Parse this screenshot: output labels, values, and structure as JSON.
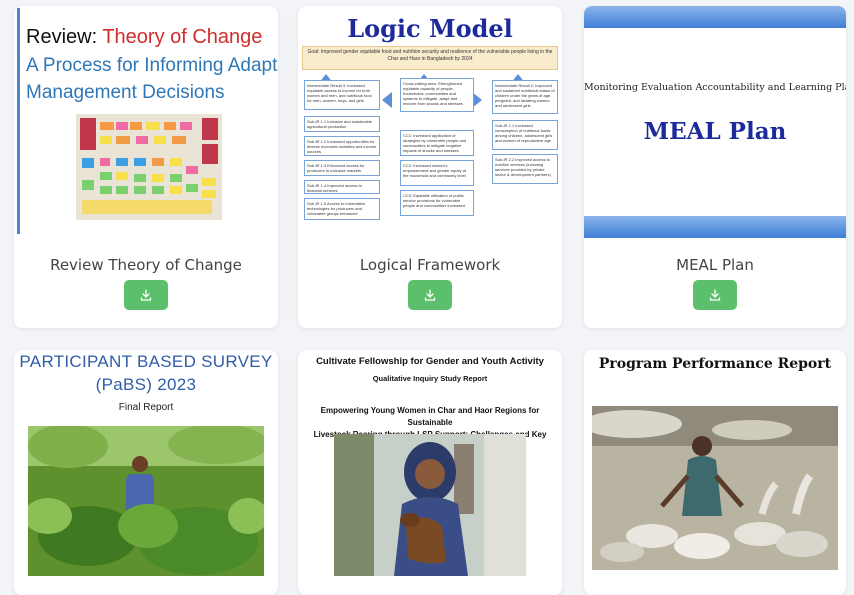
{
  "cards": [
    {
      "label": "Review Theory of Change",
      "thumb_line1_a": "Review: ",
      "thumb_line1_b": "Theory of Change",
      "thumb_line2": "A Process for Informing Adaptive",
      "thumb_line3": "Management Decisions"
    },
    {
      "label": "Logical Framework",
      "thumb_title": "Logic Model",
      "goal": "Goal: Improved gender equitable food and nutrition security and resilience of the vulnerable people living in the Char and Haor in Bangladesh by 2024",
      "boxes": [
        "Intermediate Result 3: Increased equitable access to income for both women and men, and nutritious food for men, women, boys, and girls",
        "Cross-cutting area: Strengthened equitable capacity of people, households, communities and systems to mitigate, adapt and recover from shocks and stresses",
        "Intermediate Result 2: Improved and sustained nutritional status of children under the years of age, pregnant, and lactating women and adolescent girls",
        "Sub-IR 1.1 Inclusive and sustainable agricultural production",
        "Sub-IR 1.2 Increased opportunities for diverse economic activities and income sources",
        "Sub-IR 1.3 Enhanced access for producers to inclusive markets",
        "Sub-IR 1.4 Improved access to financial services",
        "Sub-IR 1.5 Access to information technologies for producers and vulnerable groups enhanced",
        "CC1: Increased application of strategies by vulnerable people and communities to mitigate negative impacts of shocks and stresses",
        "CC2: Increased women's empowerment and gender equity at the household and community level",
        "CC3: Equitable utilization of public service provisions for vulnerable people and communities increased",
        "Sub-IR 2.1 Increased consumption of nutritious foods among children, adolescent girls and women of reproductive age",
        "Sub-IR 2.2 Improved access to nutrition services (including services provided by private sector & development partners)"
      ]
    },
    {
      "label": "MEAL Plan",
      "thumb_subtitle": "Monitoring Evaluation Accountability  and Learning  Plan",
      "thumb_title": "MEAL Plan"
    },
    {
      "thumb_title_1": "PARTICIPANT BASED SURVEY",
      "thumb_title_2": "(PaBS) 2023",
      "thumb_subtitle": "Final Report"
    },
    {
      "thumb_title": "Cultivate Fellowship for Gender and Youth Activity",
      "thumb_subtitle": "Qualitative Inquiry Study Report",
      "thumb_heading_1": "Empowering Young Women in Char and Haor Regions for Sustainable",
      "thumb_heading_2": "Livestock Rearing through LSP Support: Challenges and Key Learnings"
    },
    {
      "thumb_title": "Program Performance Report"
    }
  ],
  "icons": {
    "download": "download-icon"
  },
  "colors": {
    "download_button": "#5cbf6b",
    "accent_blue": "#1d2a9c",
    "red": "#d22d2d"
  }
}
